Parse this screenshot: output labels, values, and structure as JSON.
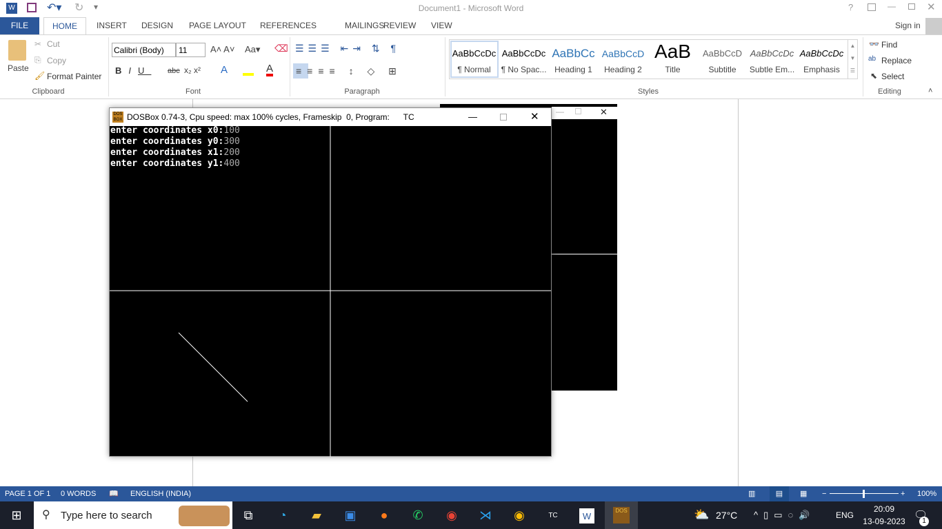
{
  "window": {
    "title": "Document1 - Microsoft Word",
    "sign_in": "Sign in"
  },
  "tabs": [
    "FILE",
    "HOME",
    "INSERT",
    "DESIGN",
    "PAGE LAYOUT",
    "REFERENCES",
    "MAILINGS",
    "REVIEW",
    "VIEW"
  ],
  "clipboard": {
    "paste": "Paste",
    "cut": "Cut",
    "copy": "Copy",
    "format_painter": "Format Painter",
    "label": "Clipboard"
  },
  "font": {
    "name": "Calibri (Body)",
    "size": "11",
    "label": "Font"
  },
  "paragraph": {
    "label": "Paragraph"
  },
  "styles": {
    "label": "Styles",
    "items": [
      {
        "preview": "AaBbCcDc",
        "name": "¶ Normal"
      },
      {
        "preview": "AaBbCcDc",
        "name": "¶ No Spac..."
      },
      {
        "preview": "AaBbCc",
        "name": "Heading 1"
      },
      {
        "preview": "AaBbCcD",
        "name": "Heading 2"
      },
      {
        "preview": "AaB",
        "name": "Title"
      },
      {
        "preview": "AaBbCcD",
        "name": "Subtitle"
      },
      {
        "preview": "AaBbCcDc",
        "name": "Subtle Em..."
      },
      {
        "preview": "AaBbCcDc",
        "name": "Emphasis"
      }
    ]
  },
  "editing": {
    "find": "Find",
    "replace": "Replace",
    "select": "Select",
    "label": "Editing"
  },
  "dosbox": {
    "title": "DOSBox 0.74-3, Cpu speed: max 100% cycles, Frameskip  0, Program:      TC",
    "lines": [
      {
        "prompt": "enter coordinates x0:",
        "value": "100"
      },
      {
        "prompt": "enter coordinates y0:",
        "value": "300"
      },
      {
        "prompt": "enter coordinates x1:",
        "value": "200"
      },
      {
        "prompt": "enter coordinates y1:",
        "value": "400"
      }
    ]
  },
  "status": {
    "page": "PAGE 1 OF 1",
    "words": "0 WORDS",
    "language": "ENGLISH (INDIA)",
    "zoom": "100%",
    "zoom_level": 100
  },
  "taskbar": {
    "search_placeholder": "Type here to search",
    "weather": "27°C",
    "lang": "ENG",
    "time": "20:09",
    "date": "13-09-2023",
    "notifications": "1"
  },
  "colors": {
    "word_blue": "#2b579a"
  }
}
